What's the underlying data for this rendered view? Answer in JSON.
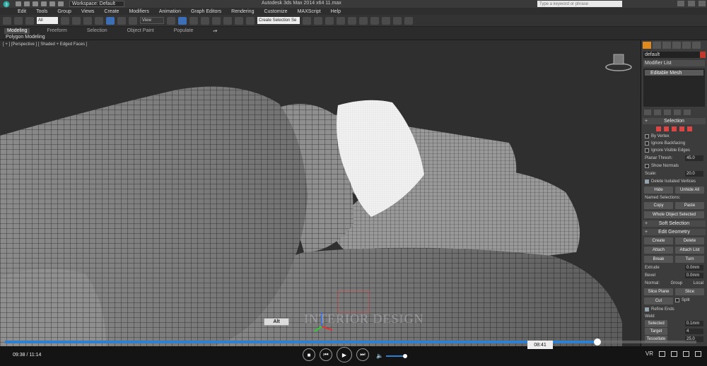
{
  "titlebar": {
    "workspace": "Workspace: Default",
    "app_title": "Autodesk 3ds Max  2014 x64     11.max",
    "search_placeholder": "Type a keyword or phrase"
  },
  "menu": [
    "Edit",
    "Tools",
    "Group",
    "Views",
    "Create",
    "Modifiers",
    "Animation",
    "Graph Editors",
    "Rendering",
    "Customize",
    "MAXScript",
    "Help"
  ],
  "toolbar": {
    "filter_value": "All",
    "coord_value": "View",
    "selection_set_value": "Create Selection Se"
  },
  "ribbon": {
    "tabs": [
      "Modeling",
      "Freeform",
      "Selection",
      "Object Paint",
      "Populate"
    ],
    "active_tab": "Modeling",
    "sub_label": "Polygon Modeling"
  },
  "viewport": {
    "label": "[ + ] [Perspective ] [ Shaded + Edged Faces ]",
    "alt_tooltip": "Alt",
    "watermark": "INTERIOR DESIGN"
  },
  "command_panel": {
    "object_name": "default",
    "modifier_list": "Modifier List",
    "stack_item": "Editable Mesh",
    "selection": {
      "title": "Selection",
      "by_vertex": "By Vertex",
      "ignore_backfacing": "Ignore Backfacing",
      "ignore_visible_edges": "Ignore Visible Edges",
      "planar_thresh_label": "Planar Thresh:",
      "planar_thresh_value": "45.0",
      "show_normals": "Show Normals",
      "scale_label": "Scale:",
      "scale_value": "20.0",
      "delete_isolated": "Delete Isolated Vertices",
      "hide": "Hide",
      "unhide_all": "Unhide All",
      "named_selections": "Named Selections:",
      "copy": "Copy",
      "paste": "Paste",
      "status": "Whole Object Selected"
    },
    "soft_selection": "Soft Selection",
    "edit_geometry": {
      "title": "Edit Geometry",
      "create": "Create",
      "delete": "Delete",
      "attach": "Attach",
      "attach_list": "Attach List",
      "break": "Break",
      "turn": "Turn",
      "extrude_label": "Extrude",
      "extrude_value": "0.0mm",
      "bevel_label": "Bevel",
      "bevel_value": "0.0mm",
      "normal_label": "Normal:",
      "group": "Group",
      "local": "Local",
      "slice_plane": "Slice Plane",
      "slice": "Slice",
      "cut": "Cut",
      "split": "Split",
      "refine_ends": "Refine Ends",
      "weld_label": "Weld",
      "selected": "Selected",
      "selected_value": "0.1mm",
      "target": "Target",
      "target_value": "4",
      "tessellate": "Tessellate",
      "tessellate_value": "25.0"
    }
  },
  "player": {
    "elapsed": "09:38 / 11:14",
    "hover_time": "08:41",
    "progress": 0.857,
    "volume": 0.7,
    "vr_label": "VR"
  }
}
